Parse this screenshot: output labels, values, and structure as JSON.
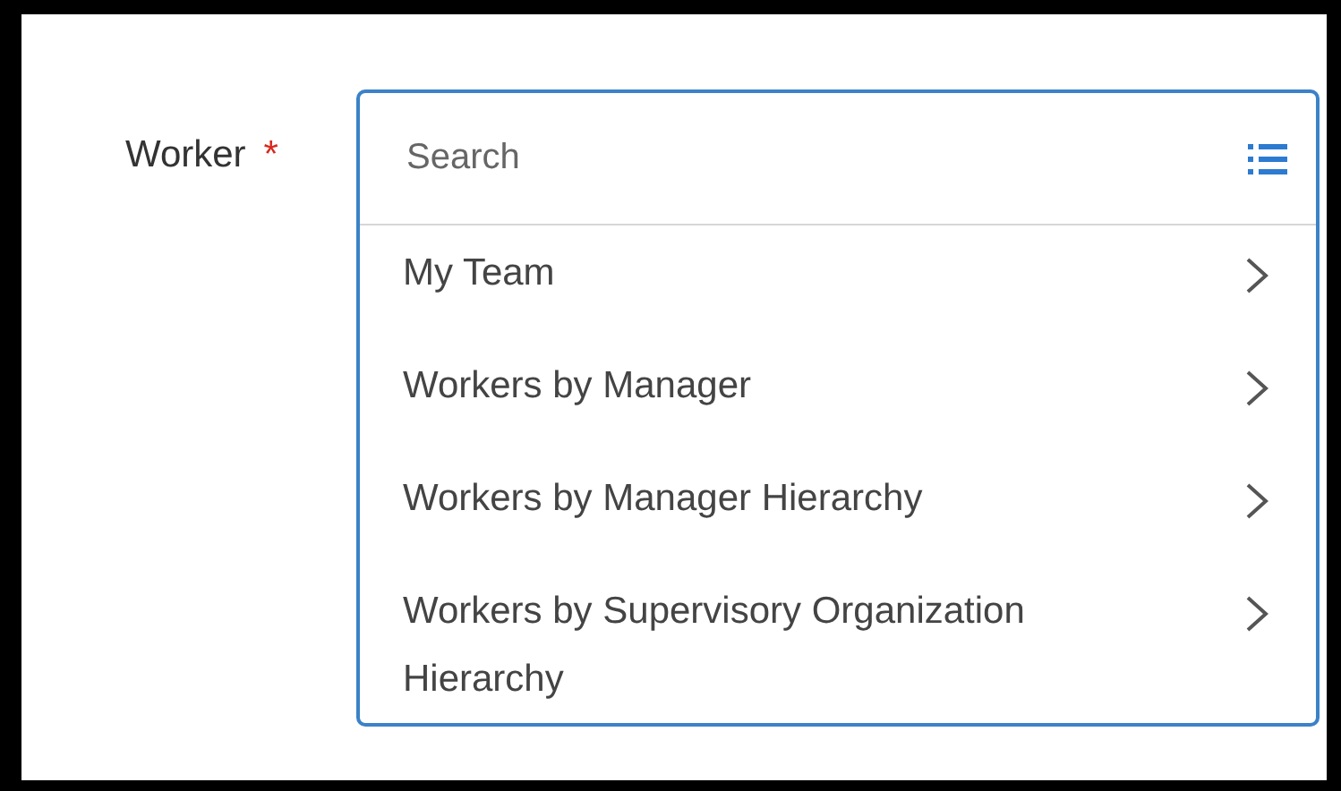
{
  "field": {
    "label": "Worker",
    "required_mark": "*",
    "placeholder": "Search"
  },
  "options": [
    {
      "label": "My Team"
    },
    {
      "label": "Workers by Manager"
    },
    {
      "label": "Workers by Manager Hierarchy"
    },
    {
      "label": "Workers by Supervisory Organization Hierarchy"
    }
  ]
}
